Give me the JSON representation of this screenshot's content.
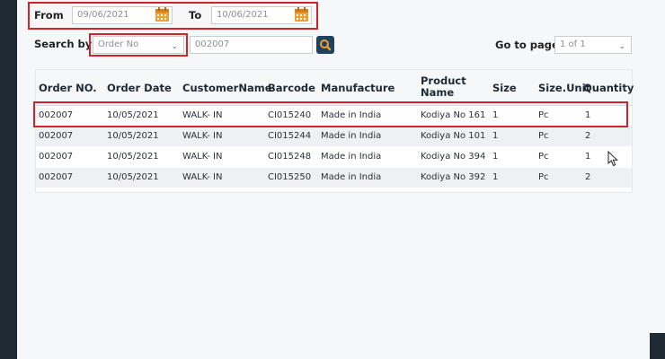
{
  "filters": {
    "from_label": "From",
    "from_value": "09/06/2021",
    "to_label": "To",
    "to_value": "10/06/2021",
    "search_by_label": "Search by :",
    "search_by_value": "Order No",
    "search_query": "002007",
    "go_to_page_label": "Go to page",
    "page_value": "1 of 1"
  },
  "table": {
    "columns": [
      "Order NO.",
      "Order Date",
      "CustomerName",
      "Barcode",
      "Manufacture",
      "Product Name",
      "Size",
      "Size.Unit",
      "Quantity"
    ],
    "rows": [
      [
        "002007",
        "10/05/2021",
        "WALK- IN",
        "CI015240",
        "Made in India",
        "Kodiya No 161",
        "1",
        "Pc",
        "1"
      ],
      [
        "002007",
        "10/05/2021",
        "WALK- IN",
        "CI015244",
        "Made in India",
        "Kodiya No 101",
        "1",
        "Pc",
        "2"
      ],
      [
        "002007",
        "10/05/2021",
        "WALK- IN",
        "CI015248",
        "Made in India",
        "Kodiya No 394",
        "1",
        "Pc",
        "1"
      ],
      [
        "002007",
        "10/05/2021",
        "WALK- IN",
        "CI015250",
        "Made in India",
        "Kodiya No 392",
        "1",
        "Pc",
        "2"
      ]
    ]
  },
  "icons": {
    "calendar": "calendar-icon",
    "search": "search-icon",
    "dropdown": "chevron-down-icon",
    "cursor": "mouse-pointer-icon"
  },
  "colors": {
    "highlight": "#d2232a",
    "calendar": "#f0a030",
    "search_button": "#21425e",
    "search_glyph": "#f0a030"
  }
}
